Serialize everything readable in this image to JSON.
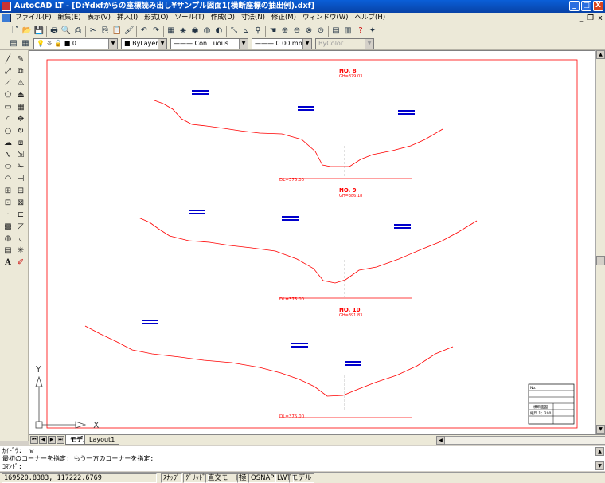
{
  "window": {
    "title": "AutoCAD LT - [D:¥dxfからの座標読み出し¥サンプル図面1(横断座標の抽出例).dxf]",
    "minimize": "_",
    "maximize": "□",
    "close": "X"
  },
  "menu": {
    "items": [
      "ファイル(F)",
      "編集(E)",
      "表示(V)",
      "挿入(I)",
      "形式(O)",
      "ツール(T)",
      "作成(D)",
      "寸法(N)",
      "修正(M)",
      "ウィンドウ(W)",
      "ヘルプ(H)"
    ],
    "mdi_minimize": "_",
    "mdi_restore": "❐",
    "mdi_close": "x"
  },
  "toolbar_props": {
    "layer_value": "0",
    "color_value": "■ ByLayer",
    "linetype_value": "——— Con...uous",
    "lineweight_value": "——— 0.00 mm",
    "plotstyle_value": "ByColor"
  },
  "drawing": {
    "sections": [
      {
        "no": "NO. 8",
        "gh": "GH=379.03",
        "dl": "DL=375.00"
      },
      {
        "no": "NO. 9",
        "gh": "GH=386.18",
        "dl": "DL=375.00"
      },
      {
        "no": "NO. 10",
        "gh": "GH=391.83",
        "dl": "DL=375.00"
      }
    ],
    "titleblock_no": "No.",
    "titleblock_name": "横断面図",
    "titleblock_scale": "縮尺 1：200",
    "ucs_x": "X",
    "ucs_y": "Y"
  },
  "tabs": {
    "model": "モデル",
    "layout1": "Layout1"
  },
  "command": {
    "line1": "ｶｲﾄﾞｳ: _w",
    "line2": "最初のコーナーを指定: もう一方のコーナーを指定:",
    "line3": "ｺﾏﾝﾄﾞ:"
  },
  "status": {
    "coords": "169520.8383, 117222.6769",
    "snap": "ｽﾅｯﾌﾟ",
    "grid": "ｸﾞﾘｯﾄﾞ",
    "ortho": "直交モード",
    "polar": "極",
    "osnap": "OSNAP",
    "lwt": "LWT",
    "model": "モデル"
  },
  "colors": {
    "title_bar": "#0a5fd8",
    "drawing_red": "#ff0000",
    "bar_blue": "#0000cc"
  }
}
